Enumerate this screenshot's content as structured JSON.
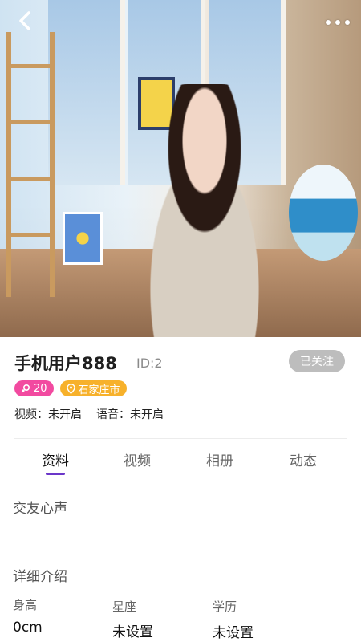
{
  "header": {
    "back_icon": "chevron-left-icon",
    "more_icon": "more-dots-icon"
  },
  "profile": {
    "name": "手机用户888",
    "id_text": "ID:2",
    "follow_label": "已关注",
    "age_badge": "20",
    "location_badge": "石家庄市",
    "video_status": "视频：未开启",
    "voice_status": "语音：未开启"
  },
  "tabs": [
    {
      "label": "资料",
      "active": true
    },
    {
      "label": "视频",
      "active": false
    },
    {
      "label": "相册",
      "active": false
    },
    {
      "label": "动态",
      "active": false
    }
  ],
  "sections": {
    "voice_title": "交友心声",
    "detail_title": "详细介绍"
  },
  "details": [
    {
      "label": "身高",
      "value": "0cm"
    },
    {
      "label": "星座",
      "value": "未设置"
    },
    {
      "label": "学历",
      "value": "未设置"
    }
  ],
  "colors": {
    "accent": "#6b36c9",
    "pink_badge": "#f24aa0",
    "orange_badge": "#f7b12b",
    "follow_bg": "#bdbdbd"
  }
}
